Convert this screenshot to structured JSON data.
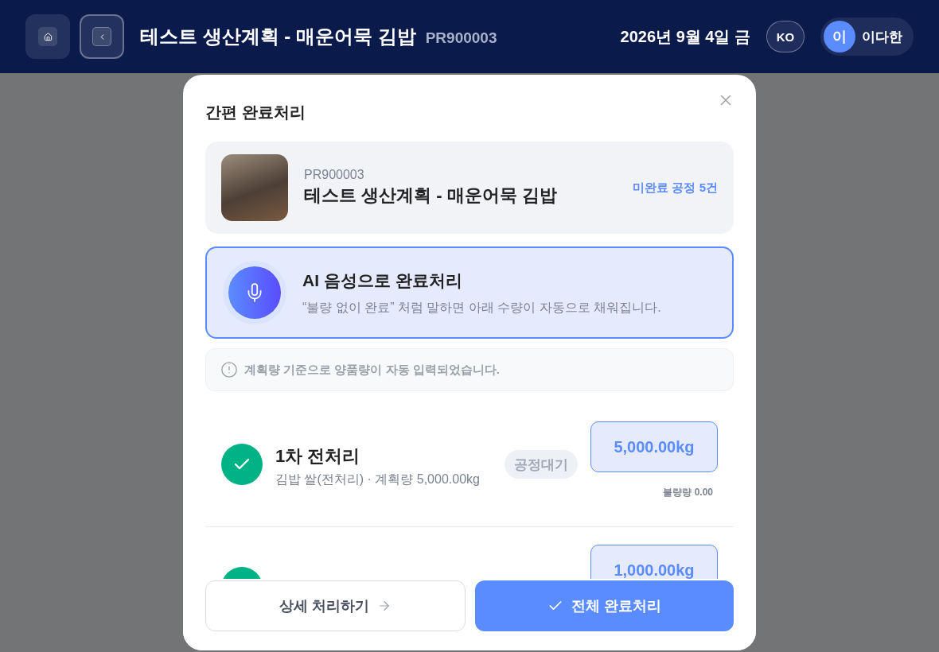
{
  "header": {
    "title": "테스트 생산계획 - 매운어묵 김밥",
    "code": "PR900003",
    "date": "2026년 9월 4일 금",
    "language": "KO",
    "user": {
      "initial": "이",
      "name": "이다한"
    }
  },
  "modal": {
    "title": "간편 완료처리",
    "product": {
      "code": "PR900003",
      "name": "테스트 생산계획 - 매운어묵 김밥",
      "pending": "미완료 공정 5건"
    },
    "voice": {
      "title": "AI 음성으로 완료처리",
      "hint": "“불량 없이 완료” 처럼 말하면 아래 수량이 자동으로 채워집니다."
    },
    "notice": "계획량 기준으로 양품량이 자동 입력되었습니다.",
    "processes": [
      {
        "name": "1차 전처리",
        "detail": "김밥 쌀(전처리) · 계획량 5,000.00kg",
        "status": "공정대기",
        "done": true,
        "quantity": "5,000.00kg",
        "defect": "불량량 0.00"
      },
      {
        "done": true,
        "quantity": "1,000.00kg"
      }
    ],
    "buttons": [
      {
        "label": "상세 처리하기",
        "kind": "secondary"
      },
      {
        "label": "전체 완료처리",
        "kind": "primary"
      }
    ]
  }
}
